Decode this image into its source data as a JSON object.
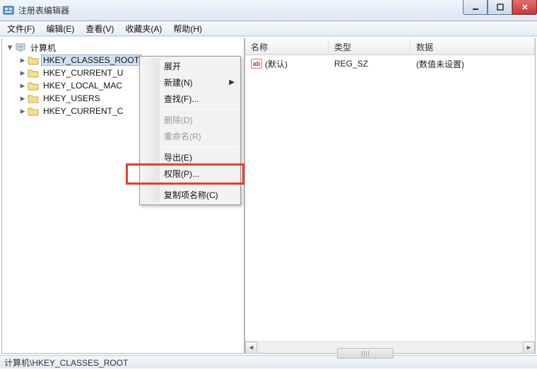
{
  "window": {
    "title": "注册表编辑器"
  },
  "menubar": {
    "file": "文件(F)",
    "edit": "编辑(E)",
    "view": "查看(V)",
    "favorites": "收藏夹(A)",
    "help": "帮助(H)"
  },
  "tree": {
    "root": "计算机",
    "items": [
      "HKEY_CLASSES_ROOT",
      "HKEY_CURRENT_USER",
      "HKEY_LOCAL_MACHINE",
      "HKEY_USERS",
      "HKEY_CURRENT_CONFIG"
    ],
    "items_truncated": [
      "HKEY_CLASSES_ROOT",
      "HKEY_CURRENT_U",
      "HKEY_LOCAL_MAC",
      "HKEY_USERS",
      "HKEY_CURRENT_C"
    ]
  },
  "list": {
    "headers": {
      "name": "名称",
      "type": "类型",
      "data": "数据"
    },
    "rows": [
      {
        "name": "(默认)",
        "type": "REG_SZ",
        "data": "(数值未设置)"
      }
    ],
    "ab_glyph": "ab"
  },
  "context_menu": {
    "expand": "展开",
    "new": "新建(N)",
    "find": "查找(F)...",
    "delete": "删除(D)",
    "rename": "重命名(R)",
    "export": "导出(E)",
    "permissions": "权限(P)...",
    "copy_key_name": "复制项名称(C)"
  },
  "statusbar": {
    "path": "计算机\\HKEY_CLASSES_ROOT"
  },
  "glyphs": {
    "tri_expanded": "▾",
    "tri_collapsed": "▸",
    "submenu_arrow": "▶",
    "scroll_left": "◄",
    "scroll_right": "►"
  },
  "colors": {
    "highlight": "#ed3b2f"
  }
}
